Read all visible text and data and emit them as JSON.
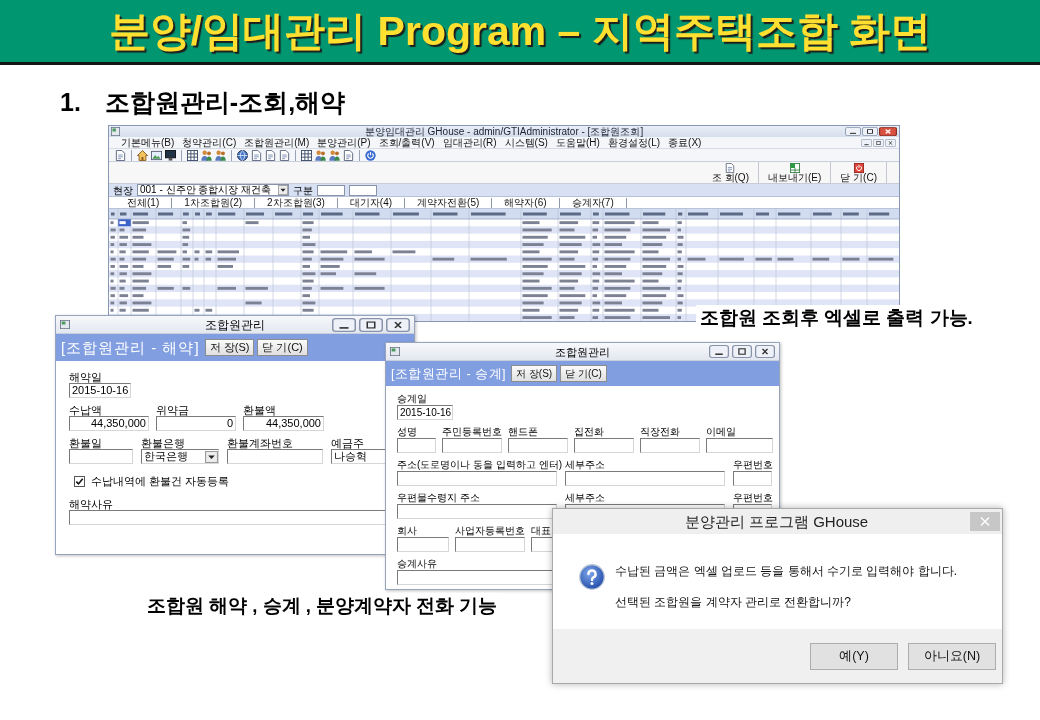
{
  "slide_title": "분양/임대관리 Program – 지역주택조합 화면",
  "section": {
    "number": "1.",
    "title": "조합원관리-조회,해약"
  },
  "main_window": {
    "title": "분양임대관리 GHouse - admin/GTIAdministrator - [조합원조회]",
    "menu": [
      "기본메뉴(B)",
      "청약관리(C)",
      "조합원관리(M)",
      "분양관리(P)",
      "조회/출력(V)",
      "임대관리(R)",
      "시스템(S)",
      "도움말(H)",
      "환경설정(L)",
      "종료(X)"
    ],
    "toolbar_buttons": [
      "조 회(Q)",
      "내보내기(E)",
      "닫 기(C)"
    ],
    "filter": {
      "site_label": "현장",
      "site_value": "001 - 신주안 종합시장 재건축",
      "type_label": "구분"
    },
    "tabs": [
      "전체(1)",
      "1차조합원(2)",
      "2차조합원(3)",
      "대기자(4)",
      "계약자전환(5)",
      "해약자(6)",
      "승계자(7)"
    ]
  },
  "caption_excel": "조합원 조회후 엑셀로 출력 가능.",
  "cancel_dialog": {
    "window_title": "조합원관리",
    "header": "[조합원관리 - 해약]",
    "buttons": [
      "저 장(S)",
      "닫 기(C)"
    ],
    "rows": [
      {
        "kind": "fields",
        "fields": [
          {
            "label": "해약일",
            "value": "2015-10-16",
            "kind": "text"
          }
        ]
      },
      {
        "kind": "fields",
        "fields": [
          {
            "label": "수납액",
            "value": "44,350,000",
            "kind": "amount"
          },
          {
            "label": "위약금",
            "value": "0",
            "kind": "amount"
          },
          {
            "label": "환불액",
            "value": "44,350,000",
            "kind": "amount"
          }
        ]
      },
      {
        "kind": "fields",
        "fields": [
          {
            "label": "환불일",
            "kind": "text"
          },
          {
            "label": "환불은행",
            "value": "한국은행",
            "kind": "select"
          },
          {
            "label": "환불계좌번호",
            "kind": "text"
          },
          {
            "label": "예금주",
            "value": "나승혁",
            "kind": "text"
          }
        ]
      },
      {
        "kind": "checkbox",
        "label": "수납내역에 환불건 자동등록",
        "checked": true
      },
      {
        "kind": "fields",
        "fields": [
          {
            "label": "해약사유",
            "kind": "text"
          }
        ]
      }
    ]
  },
  "transfer_dialog": {
    "window_title": "조합원관리",
    "header": "[조합원관리 - 승계]",
    "buttons": [
      "저 장(S)",
      "닫 기(C)"
    ],
    "rows": [
      {
        "kind": "fields",
        "fields": [
          {
            "label": "승계일",
            "value": "2015-10-16",
            "kind": "text"
          }
        ]
      },
      {
        "kind": "fields",
        "fields": [
          {
            "label": "성명",
            "kind": "text"
          },
          {
            "label": "주민등록번호",
            "kind": "text"
          },
          {
            "label": "핸드폰",
            "kind": "text"
          },
          {
            "label": "집전화",
            "kind": "text"
          },
          {
            "label": "직장전화",
            "kind": "text"
          },
          {
            "label": "이메일",
            "kind": "text"
          }
        ]
      },
      {
        "kind": "fields",
        "fields": [
          {
            "label": "주소(도로명이나 동을 입력하고 엔터)",
            "kind": "text"
          },
          {
            "label": "세부주소",
            "kind": "text"
          },
          {
            "label": "우편번호",
            "kind": "text"
          }
        ]
      },
      {
        "kind": "fields",
        "fields": [
          {
            "label": "우편물수령지 주소",
            "kind": "text"
          },
          {
            "label": "세부주소",
            "kind": "text"
          },
          {
            "label": "우편번호",
            "kind": "text"
          }
        ]
      },
      {
        "kind": "fields",
        "fields": [
          {
            "label": "회사",
            "kind": "text"
          },
          {
            "label": "사업자등록번호",
            "kind": "text"
          },
          {
            "label": "대표",
            "kind": "text"
          }
        ]
      },
      {
        "kind": "fields",
        "fields": [
          {
            "label": "승계사유",
            "kind": "text"
          }
        ]
      }
    ]
  },
  "message_box": {
    "title": "분양관리 프로그램 GHouse",
    "lines": [
      "수납된 금액은 엑셀 업로드 등을 통해서 수기로 입력해야 합니다.",
      "선택된 조합원을 계약자 관리로 전환합니까?"
    ],
    "buttons": [
      "예(Y)",
      "아니요(N)"
    ]
  },
  "caption_features": "조합원 해약 , 승계 , 분양계약자 전화 기능"
}
